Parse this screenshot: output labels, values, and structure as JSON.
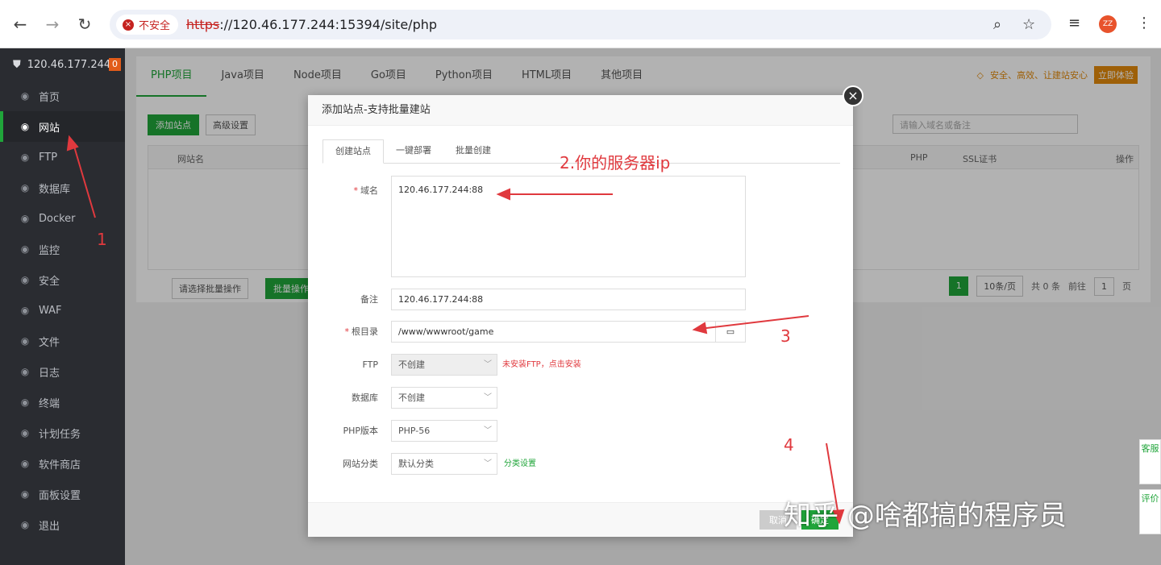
{
  "browser": {
    "insecure_label": "不安全",
    "url_scheme": "https",
    "url_rest": "://120.46.177.244:15394/site/php",
    "avatar_initials": "ZZ"
  },
  "sidebar": {
    "server": "120.46.177.244",
    "badge": "0",
    "items": [
      {
        "label": "首页",
        "icon": "home-icon"
      },
      {
        "label": "网站",
        "icon": "globe-icon"
      },
      {
        "label": "FTP",
        "icon": "ftp-icon"
      },
      {
        "label": "数据库",
        "icon": "database-icon"
      },
      {
        "label": "Docker",
        "icon": "docker-icon"
      },
      {
        "label": "监控",
        "icon": "monitor-icon"
      },
      {
        "label": "安全",
        "icon": "shield-icon"
      },
      {
        "label": "WAF",
        "icon": "waf-icon"
      },
      {
        "label": "文件",
        "icon": "folder-icon"
      },
      {
        "label": "日志",
        "icon": "log-icon"
      },
      {
        "label": "终端",
        "icon": "terminal-icon"
      },
      {
        "label": "计划任务",
        "icon": "clock-icon"
      },
      {
        "label": "软件商店",
        "icon": "store-icon"
      },
      {
        "label": "面板设置",
        "icon": "gear-icon"
      },
      {
        "label": "退出",
        "icon": "logout-icon"
      }
    ]
  },
  "main": {
    "tabs": [
      "PHP项目",
      "Java项目",
      "Node项目",
      "Go项目",
      "Python项目",
      "HTML项目",
      "其他项目"
    ],
    "promo_text": "安全、高效、让建站安心",
    "promo_button": "立即体验",
    "add_site": "添加站点",
    "advanced": "高级设置",
    "search_placeholder": "请输入域名或备注",
    "col_name": "网站名",
    "col_php": "PHP",
    "col_ssl": "SSL证书",
    "col_ops": "操作",
    "batch_select": "请选择批量操作",
    "batch_btn": "批量操作",
    "page_current": "1",
    "per_page": "10条/页",
    "total": "共 0 条",
    "goto_prefix": "前往",
    "goto_value": "1",
    "goto_suffix": "页",
    "float_service": "客服",
    "float_review": "评价"
  },
  "modal": {
    "title": "添加站点-支持批量建站",
    "tabs": [
      "创建站点",
      "一键部署",
      "批量创建"
    ],
    "domain_label": "域名",
    "domain_value": "120.46.177.244:88",
    "remark_label": "备注",
    "remark_value": "120.46.177.244:88",
    "root_label": "根目录",
    "root_value": "/www/wwwroot/game",
    "ftp_label": "FTP",
    "ftp_value": "不创建",
    "ftp_hint": "未安装FTP，点击安装",
    "db_label": "数据库",
    "db_value": "不创建",
    "php_label": "PHP版本",
    "php_value": "PHP-56",
    "cat_label": "网站分类",
    "cat_value": "默认分类",
    "cat_hint": "分类设置",
    "cancel": "取消",
    "confirm": "确定"
  },
  "annotations": {
    "a1": "1",
    "a2": "2.你的服务器ip",
    "a3": "3",
    "a4": "4",
    "watermark": "知乎 @啥都搞的程序员"
  }
}
